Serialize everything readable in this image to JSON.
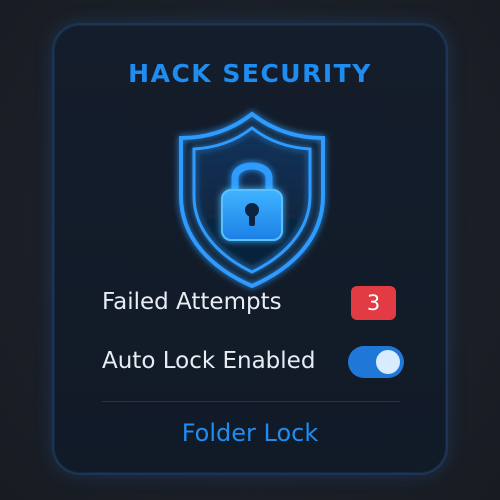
{
  "card": {
    "title": "HACK SECURITY",
    "icon": "shield-lock-icon",
    "failed_attempts": {
      "label": "Failed Attempts",
      "count": "3"
    },
    "auto_lock": {
      "label": "Auto Lock Enabled",
      "enabled": true
    },
    "footer_label": "Folder Lock"
  },
  "colors": {
    "accent": "#1e8cf0",
    "badge_red": "#e23b44",
    "toggle_on": "#1f78d8",
    "card_bg": "#131b28",
    "page_bg": "#1b1f27"
  }
}
